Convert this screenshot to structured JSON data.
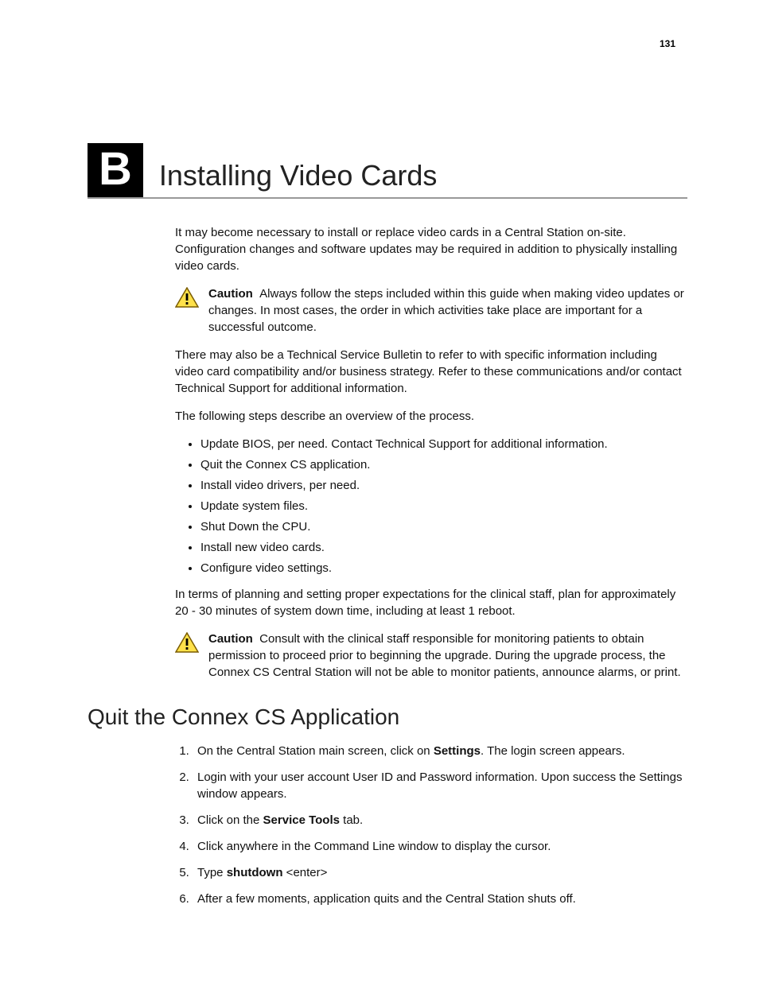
{
  "page_number": "131",
  "chapter": {
    "label": "B",
    "title": "Installing Video Cards"
  },
  "intro_p1": "It may become necessary to install or replace video cards in a Central Station on-site. Configuration changes and software updates may be required in addition to physically installing video cards.",
  "caution1_label": "Caution",
  "caution1_text": "Always follow the steps included within this guide when making video updates or changes. In most cases, the order in which activities take place are important for a successful outcome.",
  "p_tsb": "There may also be a Technical Service Bulletin to refer to with specific information including video card compatibility and/or business strategy. Refer to these communications and/or contact Technical Support for additional information.",
  "p_overview": "The following steps describe an overview of the process.",
  "bullets": [
    "Update BIOS, per need. Contact Technical Support for additional information.",
    "Quit the Connex CS application.",
    "Install video drivers, per need.",
    "Update system files.",
    "Shut Down the CPU.",
    "Install new video cards.",
    "Configure video settings."
  ],
  "p_planning": "In terms of planning and setting proper expectations for the clinical staff, plan for approximately 20 - 30 minutes of system down time, including at least 1 reboot.",
  "caution2_label": "Caution",
  "caution2_text": "Consult with the clinical staff responsible for monitoring patients to obtain permission to proceed prior to beginning the upgrade. During the upgrade process, the Connex CS Central Station will not be able to monitor patients, announce alarms, or print.",
  "section2_title": "Quit the Connex CS Application",
  "step1_a": "On the Central Station main screen, click on ",
  "step1_b": "Settings",
  "step1_c": ". The login screen appears.",
  "step2": "Login with your user account User ID and Password information. Upon success the Settings window appears.",
  "step3_a": "Click on the ",
  "step3_b": "Service Tools",
  "step3_c": " tab.",
  "step4": "Click anywhere in the Command Line window to display the cursor.",
  "step5_a": "Type ",
  "step5_b": "shutdown",
  "step5_c": " <enter>",
  "step6": "After a few moments, application quits and the Central Station shuts off."
}
